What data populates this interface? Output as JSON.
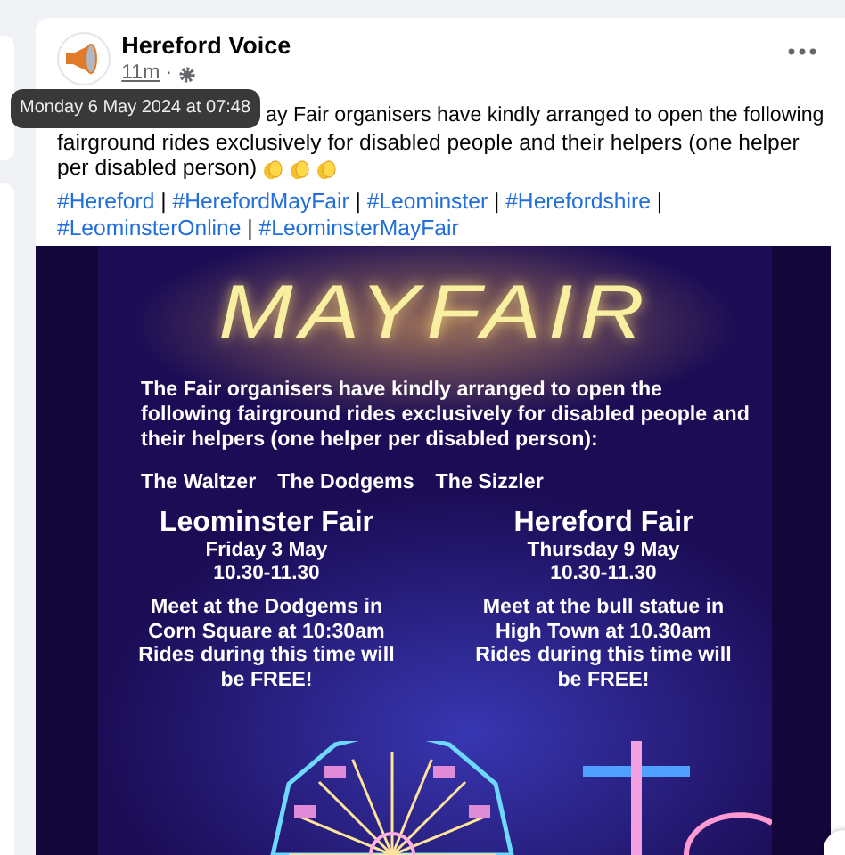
{
  "post": {
    "author": "Hereford Voice",
    "time": "11m",
    "time_separator": "·",
    "tooltip": "Monday 6 May 2024 at 07:48",
    "text_first_line": "ay Fair organisers have kindly arranged to open the following",
    "text": "fairground rides exclusively for disabled people and their helpers (one helper per disabled person)",
    "trailing_icons": [
      {
        "kind": "clap"
      },
      {
        "kind": "clap"
      },
      {
        "kind": "clap"
      }
    ],
    "hashtags": [
      "#Hereford",
      "#HerefordMayFair",
      "#Leominster",
      "#Herefordshire",
      "#LeominsterOnline",
      "#LeominsterMayFair"
    ],
    "hashtag_separator": "|",
    "poster": {
      "title": "MAYFAIR",
      "intro": "The Fair organisers have kindly arranged to open the following fairground rides exclusively for disabled people and their helpers (one helper per disabled person):",
      "rides": [
        "The Waltzer",
        "The Dodgems",
        "The Sizzler"
      ],
      "fairs": [
        {
          "name": "Leominster Fair",
          "date": "Friday 3 May",
          "time": "10.30-11.30",
          "details": "Meet at the Dodgems in Corn Square at 10:30am",
          "note": "Rides during this time will be FREE!"
        },
        {
          "name": "Hereford Fair",
          "date": "Thursday 9 May",
          "time": "10.30-11.30",
          "details": "Meet at the bull statue in High Town at 10.30am",
          "note": "Rides during this time will be FREE!"
        }
      ]
    }
  }
}
